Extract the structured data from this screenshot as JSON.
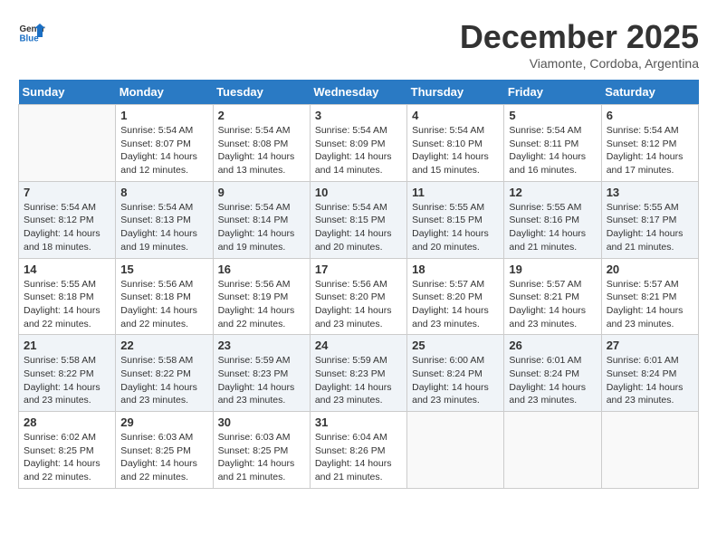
{
  "logo": {
    "general": "General",
    "blue": "Blue"
  },
  "title": "December 2025",
  "subtitle": "Viamonte, Cordoba, Argentina",
  "days_of_week": [
    "Sunday",
    "Monday",
    "Tuesday",
    "Wednesday",
    "Thursday",
    "Friday",
    "Saturday"
  ],
  "weeks": [
    [
      {
        "day": "",
        "empty": true
      },
      {
        "day": "1",
        "sunrise": "Sunrise: 5:54 AM",
        "sunset": "Sunset: 8:07 PM",
        "daylight": "Daylight: 14 hours and 12 minutes."
      },
      {
        "day": "2",
        "sunrise": "Sunrise: 5:54 AM",
        "sunset": "Sunset: 8:08 PM",
        "daylight": "Daylight: 14 hours and 13 minutes."
      },
      {
        "day": "3",
        "sunrise": "Sunrise: 5:54 AM",
        "sunset": "Sunset: 8:09 PM",
        "daylight": "Daylight: 14 hours and 14 minutes."
      },
      {
        "day": "4",
        "sunrise": "Sunrise: 5:54 AM",
        "sunset": "Sunset: 8:10 PM",
        "daylight": "Daylight: 14 hours and 15 minutes."
      },
      {
        "day": "5",
        "sunrise": "Sunrise: 5:54 AM",
        "sunset": "Sunset: 8:11 PM",
        "daylight": "Daylight: 14 hours and 16 minutes."
      },
      {
        "day": "6",
        "sunrise": "Sunrise: 5:54 AM",
        "sunset": "Sunset: 8:12 PM",
        "daylight": "Daylight: 14 hours and 17 minutes."
      }
    ],
    [
      {
        "day": "7",
        "sunrise": "Sunrise: 5:54 AM",
        "sunset": "Sunset: 8:12 PM",
        "daylight": "Daylight: 14 hours and 18 minutes."
      },
      {
        "day": "8",
        "sunrise": "Sunrise: 5:54 AM",
        "sunset": "Sunset: 8:13 PM",
        "daylight": "Daylight: 14 hours and 19 minutes."
      },
      {
        "day": "9",
        "sunrise": "Sunrise: 5:54 AM",
        "sunset": "Sunset: 8:14 PM",
        "daylight": "Daylight: 14 hours and 19 minutes."
      },
      {
        "day": "10",
        "sunrise": "Sunrise: 5:54 AM",
        "sunset": "Sunset: 8:15 PM",
        "daylight": "Daylight: 14 hours and 20 minutes."
      },
      {
        "day": "11",
        "sunrise": "Sunrise: 5:55 AM",
        "sunset": "Sunset: 8:15 PM",
        "daylight": "Daylight: 14 hours and 20 minutes."
      },
      {
        "day": "12",
        "sunrise": "Sunrise: 5:55 AM",
        "sunset": "Sunset: 8:16 PM",
        "daylight": "Daylight: 14 hours and 21 minutes."
      },
      {
        "day": "13",
        "sunrise": "Sunrise: 5:55 AM",
        "sunset": "Sunset: 8:17 PM",
        "daylight": "Daylight: 14 hours and 21 minutes."
      }
    ],
    [
      {
        "day": "14",
        "sunrise": "Sunrise: 5:55 AM",
        "sunset": "Sunset: 8:18 PM",
        "daylight": "Daylight: 14 hours and 22 minutes."
      },
      {
        "day": "15",
        "sunrise": "Sunrise: 5:56 AM",
        "sunset": "Sunset: 8:18 PM",
        "daylight": "Daylight: 14 hours and 22 minutes."
      },
      {
        "day": "16",
        "sunrise": "Sunrise: 5:56 AM",
        "sunset": "Sunset: 8:19 PM",
        "daylight": "Daylight: 14 hours and 22 minutes."
      },
      {
        "day": "17",
        "sunrise": "Sunrise: 5:56 AM",
        "sunset": "Sunset: 8:20 PM",
        "daylight": "Daylight: 14 hours and 23 minutes."
      },
      {
        "day": "18",
        "sunrise": "Sunrise: 5:57 AM",
        "sunset": "Sunset: 8:20 PM",
        "daylight": "Daylight: 14 hours and 23 minutes."
      },
      {
        "day": "19",
        "sunrise": "Sunrise: 5:57 AM",
        "sunset": "Sunset: 8:21 PM",
        "daylight": "Daylight: 14 hours and 23 minutes."
      },
      {
        "day": "20",
        "sunrise": "Sunrise: 5:57 AM",
        "sunset": "Sunset: 8:21 PM",
        "daylight": "Daylight: 14 hours and 23 minutes."
      }
    ],
    [
      {
        "day": "21",
        "sunrise": "Sunrise: 5:58 AM",
        "sunset": "Sunset: 8:22 PM",
        "daylight": "Daylight: 14 hours and 23 minutes."
      },
      {
        "day": "22",
        "sunrise": "Sunrise: 5:58 AM",
        "sunset": "Sunset: 8:22 PM",
        "daylight": "Daylight: 14 hours and 23 minutes."
      },
      {
        "day": "23",
        "sunrise": "Sunrise: 5:59 AM",
        "sunset": "Sunset: 8:23 PM",
        "daylight": "Daylight: 14 hours and 23 minutes."
      },
      {
        "day": "24",
        "sunrise": "Sunrise: 5:59 AM",
        "sunset": "Sunset: 8:23 PM",
        "daylight": "Daylight: 14 hours and 23 minutes."
      },
      {
        "day": "25",
        "sunrise": "Sunrise: 6:00 AM",
        "sunset": "Sunset: 8:24 PM",
        "daylight": "Daylight: 14 hours and 23 minutes."
      },
      {
        "day": "26",
        "sunrise": "Sunrise: 6:01 AM",
        "sunset": "Sunset: 8:24 PM",
        "daylight": "Daylight: 14 hours and 23 minutes."
      },
      {
        "day": "27",
        "sunrise": "Sunrise: 6:01 AM",
        "sunset": "Sunset: 8:24 PM",
        "daylight": "Daylight: 14 hours and 23 minutes."
      }
    ],
    [
      {
        "day": "28",
        "sunrise": "Sunrise: 6:02 AM",
        "sunset": "Sunset: 8:25 PM",
        "daylight": "Daylight: 14 hours and 22 minutes."
      },
      {
        "day": "29",
        "sunrise": "Sunrise: 6:03 AM",
        "sunset": "Sunset: 8:25 PM",
        "daylight": "Daylight: 14 hours and 22 minutes."
      },
      {
        "day": "30",
        "sunrise": "Sunrise: 6:03 AM",
        "sunset": "Sunset: 8:25 PM",
        "daylight": "Daylight: 14 hours and 21 minutes."
      },
      {
        "day": "31",
        "sunrise": "Sunrise: 6:04 AM",
        "sunset": "Sunset: 8:26 PM",
        "daylight": "Daylight: 14 hours and 21 minutes."
      },
      {
        "day": "",
        "empty": true
      },
      {
        "day": "",
        "empty": true
      },
      {
        "day": "",
        "empty": true
      }
    ]
  ]
}
